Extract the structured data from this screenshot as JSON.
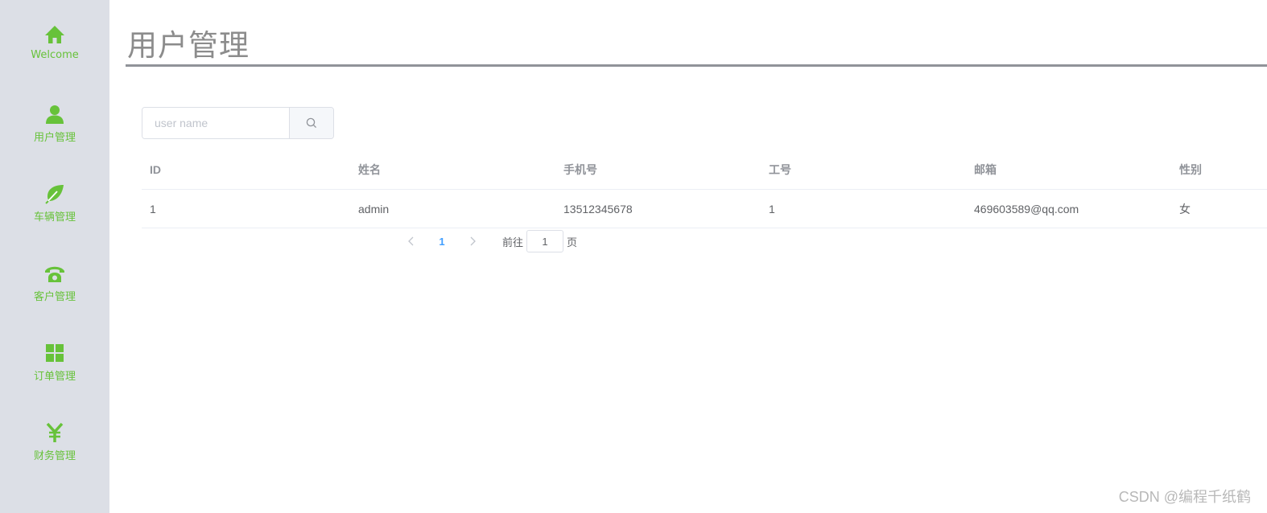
{
  "sidebar": {
    "items": [
      {
        "label": "Welcome",
        "icon": "home-icon"
      },
      {
        "label": "用户管理",
        "icon": "user-icon"
      },
      {
        "label": "车辆管理",
        "icon": "leaf-icon"
      },
      {
        "label": "客户管理",
        "icon": "phone-icon"
      },
      {
        "label": "订单管理",
        "icon": "grid-icon"
      },
      {
        "label": "财务管理",
        "icon": "yen-icon"
      }
    ]
  },
  "colors": {
    "accent": "#67c23a",
    "sidebar_bg": "#dcdfe6",
    "active_page": "#409eff"
  },
  "page": {
    "title": "用户管理"
  },
  "search": {
    "placeholder": "user name",
    "value": "",
    "icon": "search-icon"
  },
  "table": {
    "columns": [
      "ID",
      "姓名",
      "手机号",
      "工号",
      "邮箱",
      "性别"
    ],
    "rows": [
      [
        "1",
        "admin",
        "13512345678",
        "1",
        "469603589@qq.com",
        "女"
      ]
    ]
  },
  "pagination": {
    "current_page": "1",
    "goto_label": "前往",
    "goto_value": "1",
    "page_unit": "页"
  },
  "watermark": "CSDN @编程千纸鹤"
}
